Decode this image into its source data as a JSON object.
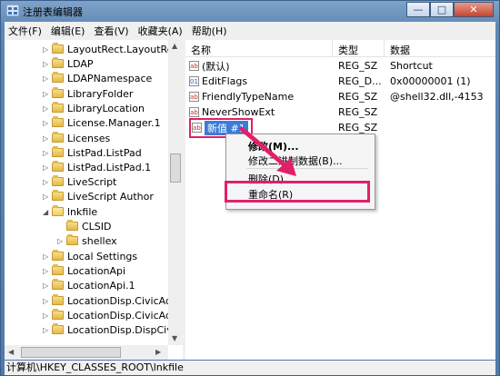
{
  "window": {
    "title": "注册表编辑器",
    "minimize": "—",
    "maximize": "□",
    "close": "✕"
  },
  "menu": [
    "文件(F)",
    "编辑(E)",
    "查看(V)",
    "收藏夹(A)",
    "帮助(H)"
  ],
  "tree": [
    "LayoutRect.LayoutRect",
    "LDAP",
    "LDAPNamespace",
    "LibraryFolder",
    "LibraryLocation",
    "License.Manager.1",
    "Licenses",
    "ListPad.ListPad",
    "ListPad.ListPad.1",
    "LiveScript",
    "LiveScript Author",
    "lnkfile",
    "CLSID",
    "shellex",
    "Local Settings",
    "LocationApi",
    "LocationApi.1",
    "LocationDisp.CivicAddr",
    "LocationDisp.CivicAddr",
    "LocationDisp.DispCivic"
  ],
  "list": {
    "headers": [
      "名称",
      "类型",
      "数据"
    ],
    "rows": [
      {
        "name": "(默认)",
        "type": "REG_SZ",
        "data": "Shortcut",
        "icon": "string-value-icon"
      },
      {
        "name": "EditFlags",
        "type": "REG_D...",
        "data": "0x00000001 (1)",
        "icon": "binary-value-icon"
      },
      {
        "name": "FriendlyTypeName",
        "type": "REG_SZ",
        "data": "@shell32.dll,-4153",
        "icon": "string-value-icon"
      },
      {
        "name": "NeverShowExt",
        "type": "REG_SZ",
        "data": "",
        "icon": "string-value-icon"
      },
      {
        "name": "新值 #1",
        "type": "REG_SZ",
        "data": "",
        "icon": "string-value-icon"
      }
    ]
  },
  "context_menu": {
    "modify": "修改(M)...",
    "modify_binary": "修改二进制数据(B)...",
    "delete": "删除(D)",
    "rename": "重命名(R)"
  },
  "status": "计算机\\HKEY_CLASSES_ROOT\\lnkfile",
  "colors": {
    "highlight": "#e0206a",
    "selection": "#3d7bd6"
  }
}
